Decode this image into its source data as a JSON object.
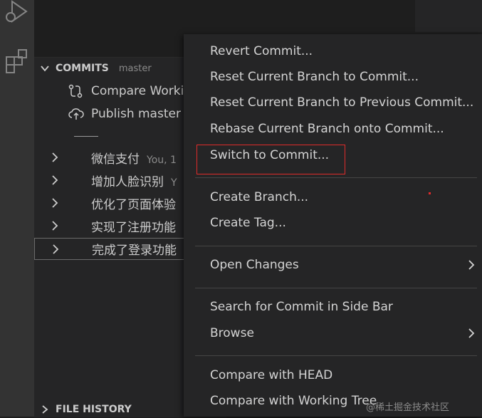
{
  "sidebar": {
    "section_title": "COMMITS",
    "branch": "master",
    "actions": [
      {
        "label": "Compare Worki",
        "icon": "compare-icon"
      },
      {
        "label": "Publish master",
        "icon": "cloud-upload-icon"
      }
    ],
    "commits": [
      {
        "message": "微信支付",
        "meta": "You, 1"
      },
      {
        "message": "增加人脸识别",
        "meta": "Y"
      },
      {
        "message": "优化了页面体验",
        "meta": ""
      },
      {
        "message": "实现了注册功能",
        "meta": ""
      },
      {
        "message": "完成了登录功能",
        "meta": ""
      }
    ],
    "file_history_title": "FILE HISTORY"
  },
  "context_menu": {
    "items": [
      {
        "label": "Revert Commit..."
      },
      {
        "label": "Reset Current Branch to Commit..."
      },
      {
        "label": "Reset Current Branch to Previous Commit..."
      },
      {
        "label": "Rebase Current Branch onto Commit..."
      },
      {
        "label": "Switch to Commit..."
      },
      {
        "label": "Create Branch..."
      },
      {
        "label": "Create Tag..."
      },
      {
        "label": "Open Changes"
      },
      {
        "label": "Search for Commit in Side Bar"
      },
      {
        "label": "Browse"
      },
      {
        "label": "Compare with HEAD"
      },
      {
        "label": "Compare with Working Tree"
      }
    ]
  },
  "watermark": "@稀土掘金技术社区",
  "colors": {
    "highlight": "#e02b2b",
    "menu_bg": "#252526",
    "activity_bar": "#333333"
  }
}
